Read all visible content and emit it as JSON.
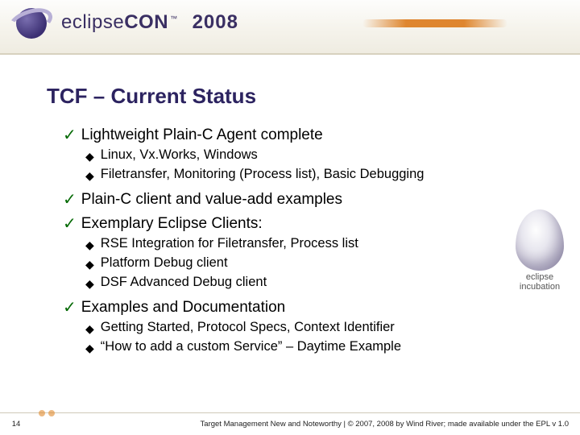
{
  "header": {
    "logo_plain": "eclipse",
    "logo_bold": "CON",
    "tm": "™",
    "year": "2008"
  },
  "title": "TCF – Current Status",
  "bullets": {
    "b1": "Lightweight Plain-C Agent complete",
    "b1_1": "Linux, Vx.Works, Windows",
    "b1_2": "Filetransfer, Monitoring (Process list), Basic Debugging",
    "b2": "Plain-C client and value-add examples",
    "b3": "Exemplary Eclipse Clients:",
    "b3_1": "RSE Integration for Filetransfer, Process list",
    "b3_2": "Platform Debug client",
    "b3_3": "DSF Advanced Debug client",
    "b4": "Examples and Documentation",
    "b4_1": "Getting Started, Protocol Specs, Context Identifier",
    "b4_2": "“How to add a custom Service” – Daytime Example"
  },
  "badge": {
    "line1": "eclipse",
    "line2": "incubation"
  },
  "footer": {
    "page": "14",
    "text": "Target Management New and Noteworthy | © 2007, 2008 by Wind River; made available under the EPL v 1.0"
  },
  "marks": {
    "check": "✓",
    "dot": "◆"
  }
}
